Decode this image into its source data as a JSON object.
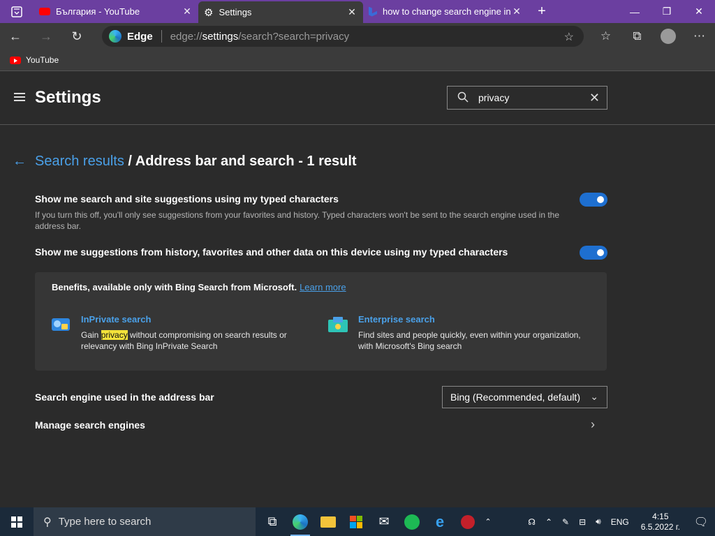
{
  "tabs": [
    {
      "title": "България - YouTube",
      "close": "✕",
      "icon": "youtube-icon"
    },
    {
      "title": "Settings",
      "close": "✕",
      "icon": "gear-icon"
    },
    {
      "title": "how to change search engine in",
      "close": "✕",
      "icon": "bing-icon"
    }
  ],
  "new_tab": "+",
  "caption": {
    "minimize": "—",
    "restore": "❐",
    "close": "✕"
  },
  "address": {
    "brand": "Edge",
    "url_prefix": "edge://",
    "url_main": "settings",
    "url_rest": "/search?search=privacy"
  },
  "bookmarks": [
    {
      "label": "YouTube"
    }
  ],
  "header": {
    "title": "Settings",
    "search_value": "privacy"
  },
  "breadcrumb": {
    "link": "Search results",
    "rest": " / Address bar and search - 1 result"
  },
  "settings": [
    {
      "title": "Show me search and site suggestions using my typed characters",
      "desc": "If you turn this off, you'll only see suggestions from your favorites and history. Typed characters won't be sent to the search engine used in the address bar.",
      "on": true
    },
    {
      "title": "Show me suggestions from history, favorites and other data on this device using my typed characters",
      "on": true
    }
  ],
  "bing_card": {
    "title": "Benefits, available only with Bing Search from Microsoft.",
    "learn_more": "Learn more",
    "features": [
      {
        "title": "InPrivate search",
        "desc_pre": "Gain ",
        "desc_hl": "privacy",
        "desc_post": " without compromising on search results or relevancy with Bing InPrivate Search"
      },
      {
        "title": "Enterprise search",
        "desc": "Find sites and people quickly, even within your organization, with Microsoft's Bing search"
      }
    ]
  },
  "search_engine": {
    "label": "Search engine used in the address bar",
    "value": "Bing (Recommended, default)"
  },
  "manage": {
    "label": "Manage search engines"
  },
  "taskbar": {
    "search_placeholder": "Type here to search",
    "lang": "ENG",
    "time": "4:15",
    "date": "6.5.2022 г."
  },
  "colors": {
    "accent": "#4aa0e8",
    "tabstrip": "#6b3fa0",
    "toggle_on": "#1e6fd0",
    "highlight": "#f3e23a"
  }
}
